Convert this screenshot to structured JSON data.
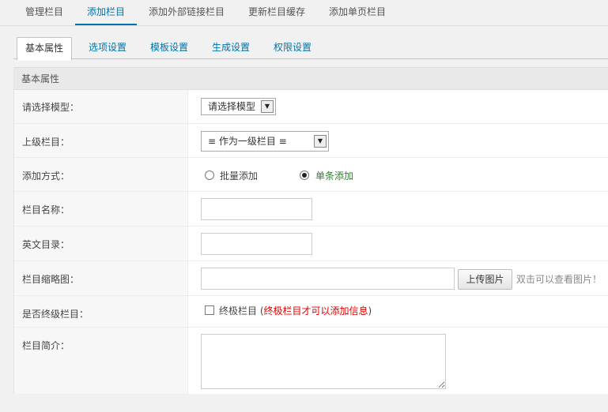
{
  "top_tabs": [
    {
      "label": "管理栏目"
    },
    {
      "label": "添加栏目"
    },
    {
      "label": "添加外部链接栏目"
    },
    {
      "label": "更新栏目缓存"
    },
    {
      "label": "添加单页栏目"
    }
  ],
  "sub_tabs": [
    {
      "label": "基本属性"
    },
    {
      "label": "选项设置"
    },
    {
      "label": "模板设置"
    },
    {
      "label": "生成设置"
    },
    {
      "label": "权限设置"
    }
  ],
  "section_title": "基本属性",
  "form": {
    "model": {
      "label": "请选择模型：",
      "selected": "请选择模型"
    },
    "parent": {
      "label": "上级栏目：",
      "selected": "≡ 作为一级栏目 ≡"
    },
    "add_mode": {
      "label": "添加方式：",
      "option_batch": "批量添加",
      "option_single": "单条添加",
      "selected": "单条添加"
    },
    "name": {
      "label": "栏目名称：",
      "value": ""
    },
    "dir": {
      "label": "英文目录：",
      "value": ""
    },
    "thumb": {
      "label": "栏目缩略图：",
      "value": "",
      "upload_button": "上传图片",
      "hint": "双击可以查看图片！"
    },
    "is_final": {
      "label": "是否终级栏目：",
      "option": "终极栏目",
      "paren_open": "(",
      "note": "终极栏目才可以添加信息",
      "paren_close": ")"
    },
    "desc": {
      "label": "栏目简介：",
      "value": ""
    }
  },
  "colors": {
    "accent": "#0073aa",
    "single_option": "#2e7d32",
    "note": "#e00000"
  }
}
